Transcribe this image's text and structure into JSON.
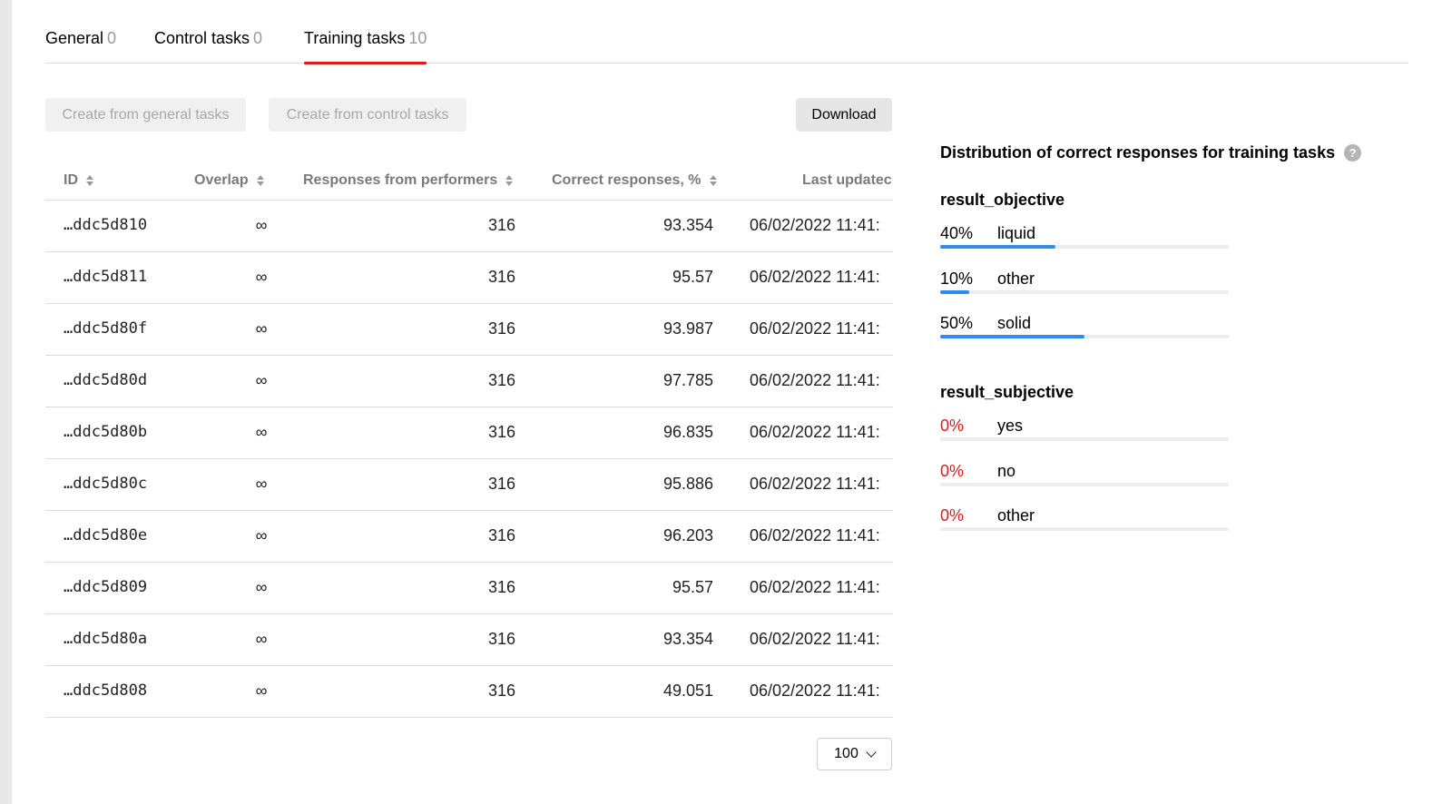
{
  "tabs": [
    {
      "label": "General",
      "count": "0",
      "active": false
    },
    {
      "label": "Control tasks",
      "count": "0",
      "active": false
    },
    {
      "label": "Training tasks",
      "count": "10",
      "active": true
    }
  ],
  "toolbar": {
    "create_general_label": "Create from general tasks",
    "create_control_label": "Create from control tasks",
    "download_label": "Download"
  },
  "table": {
    "columns": {
      "id": "ID",
      "overlap": "Overlap",
      "responses": "Responses from performers",
      "correct": "Correct responses, %",
      "updated": "Last updatec"
    },
    "rows": [
      {
        "id": "…ddc5d810",
        "overlap": "∞",
        "responses": "316",
        "correct": "93.354",
        "updated": "06/02/2022 11:41:"
      },
      {
        "id": "…ddc5d811",
        "overlap": "∞",
        "responses": "316",
        "correct": "95.57",
        "updated": "06/02/2022 11:41:"
      },
      {
        "id": "…ddc5d80f",
        "overlap": "∞",
        "responses": "316",
        "correct": "93.987",
        "updated": "06/02/2022 11:41:"
      },
      {
        "id": "…ddc5d80d",
        "overlap": "∞",
        "responses": "316",
        "correct": "97.785",
        "updated": "06/02/2022 11:41:"
      },
      {
        "id": "…ddc5d80b",
        "overlap": "∞",
        "responses": "316",
        "correct": "96.835",
        "updated": "06/02/2022 11:41:"
      },
      {
        "id": "…ddc5d80c",
        "overlap": "∞",
        "responses": "316",
        "correct": "95.886",
        "updated": "06/02/2022 11:41:"
      },
      {
        "id": "…ddc5d80e",
        "overlap": "∞",
        "responses": "316",
        "correct": "96.203",
        "updated": "06/02/2022 11:41:"
      },
      {
        "id": "…ddc5d809",
        "overlap": "∞",
        "responses": "316",
        "correct": "95.57",
        "updated": "06/02/2022 11:41:"
      },
      {
        "id": "…ddc5d80a",
        "overlap": "∞",
        "responses": "316",
        "correct": "93.354",
        "updated": "06/02/2022 11:41:"
      },
      {
        "id": "…ddc5d808",
        "overlap": "∞",
        "responses": "316",
        "correct": "49.051",
        "updated": "06/02/2022 11:41:"
      }
    ]
  },
  "pagination": {
    "page_size": "100"
  },
  "distribution": {
    "title": "Distribution of correct responses for training tasks",
    "help_icon": "?",
    "groups": [
      {
        "name": "result_objective",
        "items": [
          {
            "percent": "40%",
            "label": "liquid",
            "fraction": 0.4
          },
          {
            "percent": "10%",
            "label": "other",
            "fraction": 0.1
          },
          {
            "percent": "50%",
            "label": "solid",
            "fraction": 0.5
          }
        ]
      },
      {
        "name": "result_subjective",
        "items": [
          {
            "percent": "0%",
            "label": "yes",
            "fraction": 0
          },
          {
            "percent": "0%",
            "label": "no",
            "fraction": 0
          },
          {
            "percent": "0%",
            "label": "other",
            "fraction": 0
          }
        ]
      }
    ]
  },
  "colors": {
    "accent_red": "#e01a1a",
    "bar_blue": "#2b8df0"
  }
}
